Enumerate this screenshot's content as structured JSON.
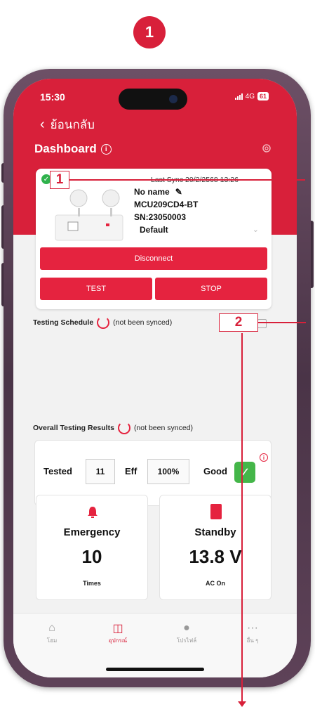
{
  "step": "1",
  "status_bar": {
    "time": "15:30",
    "network": "4G",
    "battery": "61"
  },
  "header": {
    "back_label": "ย้อนกลับ",
    "title": "Dashboard"
  },
  "device": {
    "last_sync": "Last Sync 20/2/2568 13:26",
    "name": "No name",
    "model": "MCU209CD4-BT",
    "serial": "SN:23050003",
    "profile": "Default"
  },
  "actions": {
    "disconnect": "Disconnect",
    "test": "TEST",
    "stop": "STOP"
  },
  "testing_schedule": {
    "label": "Testing Schedule",
    "status": "(not been synced)"
  },
  "overall_results": {
    "label": "Overall Testing Results",
    "status": "(not been synced)",
    "tested_label": "Tested",
    "tested_value": "11",
    "eff_label": "Eff",
    "eff_value": "100%",
    "good_label": "Good"
  },
  "emergency": {
    "label": "Emergency",
    "value": "10",
    "unit": "Times"
  },
  "standby": {
    "label": "Standby",
    "value": "13.8 V",
    "unit": "AC On"
  },
  "nav": [
    {
      "label": "โฮม",
      "icon": "home-icon"
    },
    {
      "label": "อุปกรณ์",
      "icon": "device-icon"
    },
    {
      "label": "โปรไฟล์",
      "icon": "profile-icon"
    },
    {
      "label": "อื่น ๆ",
      "icon": "more-icon"
    }
  ],
  "callouts": [
    "1",
    "2"
  ],
  "colors": {
    "brand_red": "#d8203a",
    "success_green": "#2fb24c"
  }
}
